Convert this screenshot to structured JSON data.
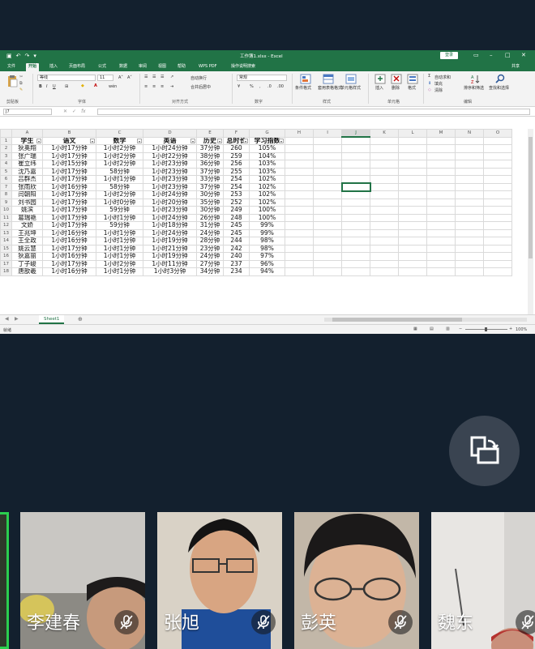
{
  "excel": {
    "title": "工作簿1.xlsx - Excel",
    "login_label": "登录",
    "share_label": "共享",
    "tabs": [
      "文件",
      "开始",
      "插入",
      "页面布局",
      "公式",
      "数据",
      "审阅",
      "视图",
      "帮助",
      "WPS PDF",
      "操作说明搜索"
    ],
    "active_tab": "开始",
    "ribbon": {
      "clipboard_label": "剪贴板",
      "font_label": "字体",
      "align_label": "对齐方式",
      "number_label": "数字",
      "styles_label": "样式",
      "cells_label": "单元格",
      "edit_label": "编辑",
      "font_name": "等线",
      "font_size": "11",
      "wrap_text": "自动换行",
      "merge_center": "合并后居中",
      "number_format": "常规",
      "cond_format": "条件格式",
      "table_format": "套用表格格式",
      "cell_style": "单元格样式",
      "insert": "插入",
      "delete": "删除",
      "format": "格式",
      "autosum": "自动求和",
      "fill": "填充",
      "clear": "清除",
      "sort_filter": "排序和筛选",
      "find_select": "查找和选择"
    },
    "name_box": "J7",
    "columns": [
      "A",
      "B",
      "C",
      "D",
      "E",
      "F",
      "G",
      "H",
      "I",
      "J",
      "K",
      "L",
      "M",
      "N",
      "O"
    ],
    "headers": [
      "学生",
      "语文",
      "数学",
      "英语",
      "历史",
      "总时长",
      "学习指数"
    ],
    "rows": [
      [
        "狄奥翔",
        "1小时17分钟",
        "1小时2分钟",
        "1小时24分钟",
        "37分钟",
        "260",
        "105%"
      ],
      [
        "张广瑞",
        "1小时17分钟",
        "1小时2分钟",
        "1小时22分钟",
        "38分钟",
        "259",
        "104%"
      ],
      [
        "崔立纬",
        "1小时15分钟",
        "1小时2分钟",
        "1小时23分钟",
        "36分钟",
        "256",
        "103%"
      ],
      [
        "沈乃嘉",
        "1小时17分钟",
        "58分钟",
        "1小时23分钟",
        "37分钟",
        "255",
        "103%"
      ],
      [
        "吕群杰",
        "1小时17分钟",
        "1小时1分钟",
        "1小时23分钟",
        "33分钟",
        "254",
        "102%"
      ],
      [
        "张雨欣",
        "1小时16分钟",
        "58分钟",
        "1小时23分钟",
        "37分钟",
        "254",
        "102%"
      ],
      [
        "闫朝阳",
        "1小时17分钟",
        "1小时2分钟",
        "1小时24分钟",
        "30分钟",
        "253",
        "102%"
      ],
      [
        "刘书园",
        "1小时17分钟",
        "1小时0分钟",
        "1小时20分钟",
        "35分钟",
        "252",
        "102%"
      ],
      [
        "姚滨",
        "1小时17分钟",
        "59分钟",
        "1小时23分钟",
        "30分钟",
        "249",
        "100%"
      ],
      [
        "葛瑞艳",
        "1小时17分钟",
        "1小时1分钟",
        "1小时24分钟",
        "26分钟",
        "248",
        "100%"
      ],
      [
        "文娇",
        "1小时17分钟",
        "59分钟",
        "1小时18分钟",
        "31分钟",
        "245",
        "99%"
      ],
      [
        "王兆坤",
        "1小时16分钟",
        "1小时1分钟",
        "1小时24分钟",
        "24分钟",
        "245",
        "99%"
      ],
      [
        "王全政",
        "1小时16分钟",
        "1小时1分钟",
        "1小时19分钟",
        "28分钟",
        "244",
        "98%"
      ],
      [
        "姚云慧",
        "1小时17分钟",
        "1小时1分钟",
        "1小时21分钟",
        "23分钟",
        "242",
        "98%"
      ],
      [
        "狄嘉丽",
        "1小时16分钟",
        "1小时1分钟",
        "1小时19分钟",
        "24分钟",
        "240",
        "97%"
      ],
      [
        "丁子峻",
        "1小时17分钟",
        "1小时2分钟",
        "1小时11分钟",
        "27分钟",
        "237",
        "96%"
      ],
      [
        "唐歆羲",
        "1小时16分钟",
        "1小时1分钟",
        "1小时3分钟",
        "34分钟",
        "234",
        "94%"
      ]
    ],
    "sheet_tab": "Sheet1",
    "status_left": "就绪",
    "zoom": "100%"
  },
  "participants": [
    {
      "name": "李建春"
    },
    {
      "name": "张旭"
    },
    {
      "name": "彭英"
    },
    {
      "name": "魏东"
    }
  ],
  "colors": {
    "excel_green": "#217346",
    "bg": "#13202e",
    "active_speaker": "#2bd04f"
  }
}
